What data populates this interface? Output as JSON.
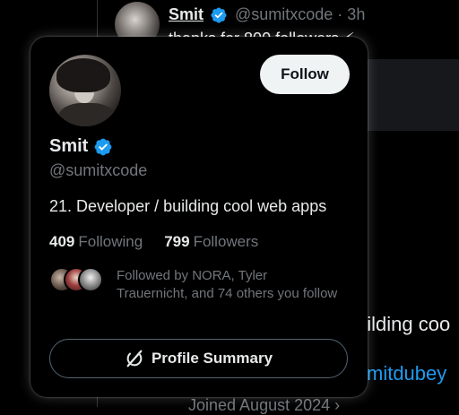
{
  "background": {
    "tweet_author_name": "Smit",
    "tweet_author_handle": "@sumitxcode · 3h",
    "tweet_text": "thanks for 800 followers ⚡",
    "bio_fragment": "uilding coo",
    "link_fragment": "mitdubey",
    "joined_fragment": "Joined August 2024 ›"
  },
  "hover_card": {
    "avatar_alt": "Smit profile photo",
    "follow_label": "Follow",
    "name": "Smit",
    "handle": "@sumitxcode",
    "bio": "21. Developer / building cool web apps",
    "following_count": "409",
    "following_label": "Following",
    "followers_count": "799",
    "followers_label": "Followers",
    "followed_by_text": "Followed by NORA, Tyler Trauernicht, and 74 others you follow",
    "summary_button_label": "Profile Summary",
    "icons": {
      "verified": "verified-badge-icon",
      "summary": "grok-icon"
    },
    "colors": {
      "accent_blue": "#1d9bf0",
      "follow_button_bg": "#eff3f4",
      "muted_text": "#71767b"
    }
  }
}
